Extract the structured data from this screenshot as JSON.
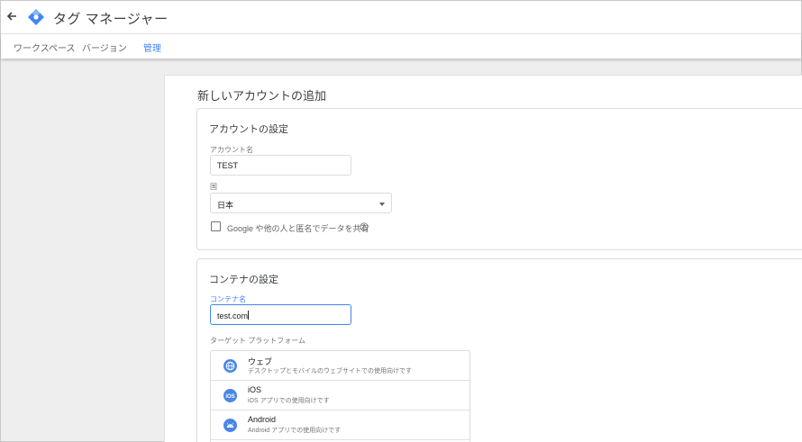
{
  "app": {
    "title": "タグ マネージャー"
  },
  "tabs": [
    {
      "label": "ワークスペース"
    },
    {
      "label": "バージョン"
    },
    {
      "label": "管理"
    }
  ],
  "page": {
    "title": "新しいアカウントの追加"
  },
  "account_section": {
    "title": "アカウントの設定",
    "account_name_label": "アカウント名",
    "account_name_value": "TEST",
    "country_label": "国",
    "country_value": "日本",
    "share_label": "Google や他の人と匿名でデータを共有"
  },
  "container_section": {
    "title": "コンテナの設定",
    "container_name_label": "コンテナ名",
    "container_name_value": "test.com",
    "platform_label": "ターゲット プラットフォーム",
    "platforms": [
      {
        "name": "ウェブ",
        "desc": "デスクトップとモバイルのウェブサイトでの使用向けです"
      },
      {
        "name": "iOS",
        "desc": "iOS アプリでの使用向けです"
      },
      {
        "name": "Android",
        "desc": "Android アプリでの使用向けです"
      }
    ]
  },
  "colors": {
    "accent": "#4285f4",
    "platform_icon": "#4a86e8"
  },
  "icons": {
    "back": "arrow-back-icon",
    "logo": "tag-manager-logo-icon",
    "help": "help-circle-icon",
    "web": "globe-icon",
    "ios": "ios-icon",
    "android": "android-icon",
    "dropdown": "caret-down-icon"
  }
}
